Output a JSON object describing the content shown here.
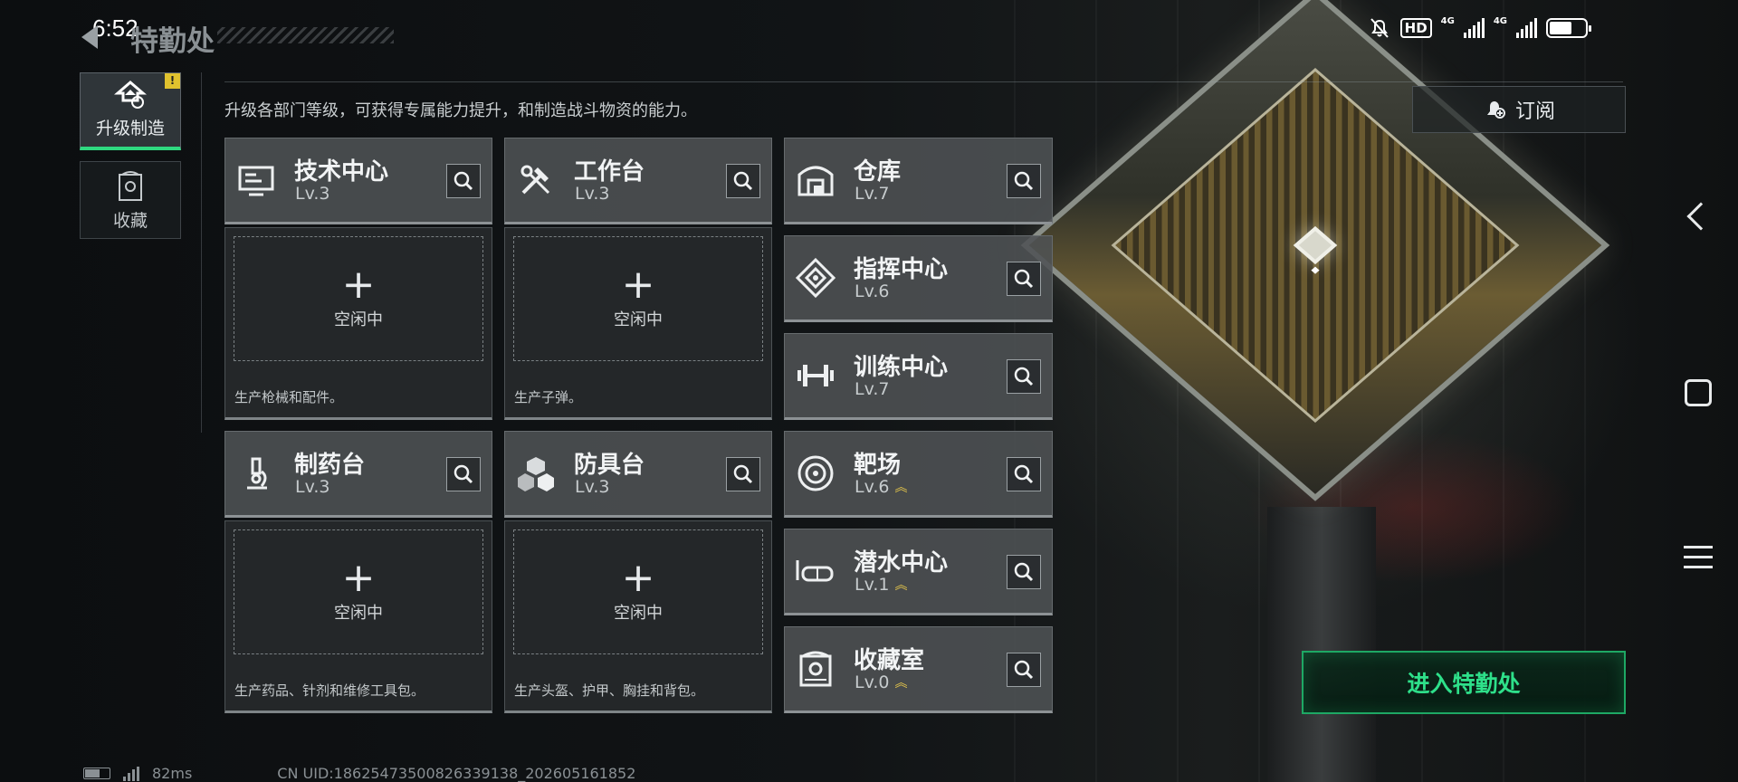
{
  "status_bar": {
    "time": "6:52",
    "hd": "HD",
    "net1": "4G",
    "net2": "4G"
  },
  "header": {
    "title": "特勤处"
  },
  "nav": {
    "tabs": [
      {
        "label": "升级制造",
        "badge": "!"
      },
      {
        "label": "收藏"
      }
    ]
  },
  "description": "升级各部门等级，可获得专属能力提升，和制造战斗物资的能力。",
  "subscribe": {
    "label": "订阅"
  },
  "departments": {
    "tech": {
      "name": "技术中心",
      "level": "Lv.3"
    },
    "workbench": {
      "name": "工作台",
      "level": "Lv.3"
    },
    "warehouse": {
      "name": "仓库",
      "level": "Lv.7"
    },
    "command": {
      "name": "指挥中心",
      "level": "Lv.6"
    },
    "training": {
      "name": "训练中心",
      "level": "Lv.7"
    },
    "pharmacy": {
      "name": "制药台",
      "level": "Lv.3"
    },
    "armor": {
      "name": "防具台",
      "level": "Lv.3"
    },
    "range": {
      "name": "靶场",
      "level": "Lv.6"
    },
    "diving": {
      "name": "潜水中心",
      "level": "Lv.1"
    },
    "collection": {
      "name": "收藏室",
      "level": "Lv.0"
    }
  },
  "production": {
    "idle_label": "空闲中",
    "tech_desc": "生产枪械和配件。",
    "workbench_desc": "生产子弹。",
    "pharmacy_desc": "生产药品、针剂和维修工具包。",
    "armor_desc": "生产头盔、护甲、胸挂和背包。"
  },
  "enter_button": {
    "label": "进入特勤处"
  },
  "footer": {
    "ping": "82ms",
    "uid": "CN UID:18625473500826339138_202605161852"
  },
  "colors": {
    "accent_green": "#2ee08a",
    "upgrade_gold": "#e8c84a",
    "badge_yellow": "#e1c22e"
  }
}
